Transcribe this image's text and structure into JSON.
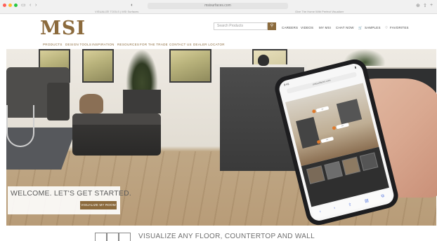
{
  "browser": {
    "address": "msisurfaces.com",
    "tab_left": "VISUALIZE TOOLS | MSI Surfaces",
    "tab_right": "Give The Home With Perfect Visualizer"
  },
  "header": {
    "logo": "MSI",
    "search_placeholder": "Search Products",
    "utility": [
      "CAREERS",
      "VIDEOS",
      "MY MSI",
      "CHAT NOW",
      "SAMPLES",
      "FAVORITES"
    ],
    "nav": [
      "PRODUCTS",
      "DESIGN TOOLS",
      "INSPIRATION",
      "RESOURCES",
      "FOR THE TRADE",
      "CONTACT US",
      "DEALER LOCATOR"
    ]
  },
  "hero": {
    "welcome": "WELCOME. LET'S GET STARTED.",
    "cta": "VISUALIZE MY ROOM",
    "phone_url": "msisurfaces.com",
    "phone_time": "9:41"
  },
  "footer": {
    "heading": "VISUALIZE ANY FLOOR, COUNTERTOP AND WALL"
  },
  "colors": {
    "brand": "#8b6a3c"
  }
}
